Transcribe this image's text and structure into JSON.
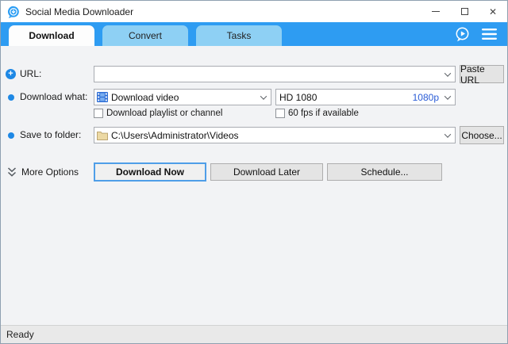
{
  "window": {
    "title": "Social Media Downloader"
  },
  "icons": {
    "close": "✕"
  },
  "tabs": [
    {
      "label": "Download",
      "active": true
    },
    {
      "label": "Convert",
      "active": false
    },
    {
      "label": "Tasks",
      "active": false
    }
  ],
  "form": {
    "url": {
      "label": "URL:",
      "value": "",
      "paste_button": "Paste URL"
    },
    "download_what": {
      "label": "Download what:",
      "selected": "Download video",
      "quality_selected": "HD 1080",
      "quality_badge": "1080p",
      "playlist_checkbox": "Download playlist or channel",
      "fps_checkbox": "60 fps if available"
    },
    "save_folder": {
      "label": "Save to folder:",
      "value": "C:\\Users\\Administrator\\Videos",
      "choose_button": "Choose..."
    },
    "more_options_label": "More Options",
    "action_buttons": {
      "download_now": "Download Now",
      "download_later": "Download Later",
      "schedule": "Schedule..."
    }
  },
  "statusbar": {
    "text": "Ready"
  },
  "colors": {
    "tabbar_blue": "#2e9cf2",
    "inactive_tab_blue": "#8ed0f4",
    "accent_blue": "#1e88e5",
    "quality_text_blue": "#2a5cd6",
    "primary_button_border": "#4f9ee8"
  }
}
